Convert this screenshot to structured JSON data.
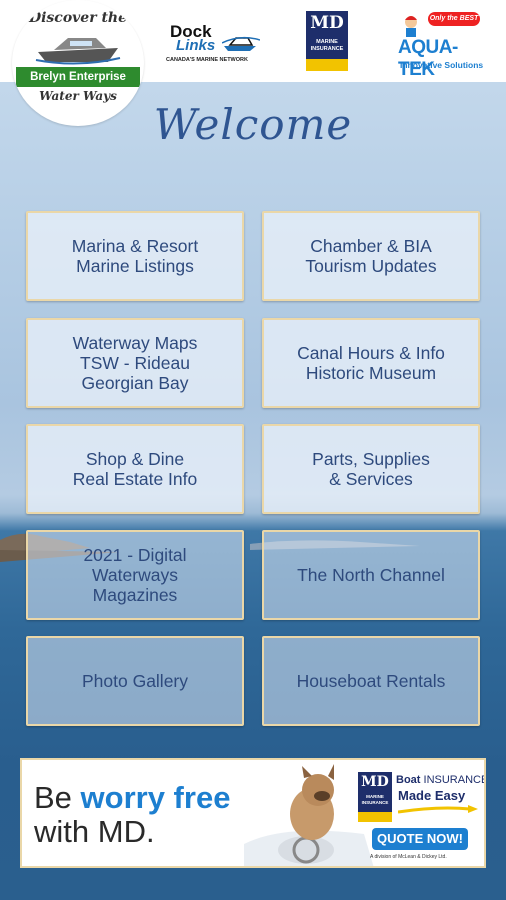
{
  "header": {
    "logo_top": "Discover the",
    "logo_brand": "Brelyn Enterprise",
    "logo_bottom": "Water Ways",
    "docklinks_word1": "Dock",
    "docklinks_word2": "Links",
    "docklinks_tagline": "CANADA'S MARINE NETWORK",
    "md_mark": "MD",
    "md_text": "MARINE\nINSURANCE",
    "aquatek_badge": "Only the BEST",
    "aquatek_name": "AQUA-TEK",
    "aquatek_tagline": "Innovative Solutions"
  },
  "welcome": "Welcome",
  "menu": [
    {
      "label": "Marina & Resort\nMarine Listings"
    },
    {
      "label": "Chamber & BIA\nTourism Updates"
    },
    {
      "label": "Waterway Maps\nTSW - Rideau\nGeorgian Bay"
    },
    {
      "label": "Canal Hours & Info\nHistoric Museum"
    },
    {
      "label": "Shop & Dine\nReal Estate Info"
    },
    {
      "label": "Parts, Supplies\n& Services"
    },
    {
      "label": "2021 - Digital\nWaterways\nMagazines"
    },
    {
      "label": "The North Channel"
    },
    {
      "label": "Photo Gallery"
    },
    {
      "label": "Houseboat Rentals"
    }
  ],
  "ad": {
    "line1_a": "Be ",
    "line1_b": "worry free",
    "line2": "with MD.",
    "md_mark": "MD",
    "md_text": "MARINE\nINSURANCE",
    "boat_a": "Boat",
    "boat_b": " INSURANCE",
    "made_easy": "Made Easy",
    "quote": "QUOTE NOW!",
    "division": "A division of McLean & Dickey Ltd."
  },
  "colors": {
    "title_blue": "#2f5591",
    "button_text": "#2e4a7d",
    "button_border": "#ead7a8",
    "accent_blue": "#1d7fd0",
    "md_navy": "#1e2e6b",
    "md_yellow": "#f2c300"
  }
}
